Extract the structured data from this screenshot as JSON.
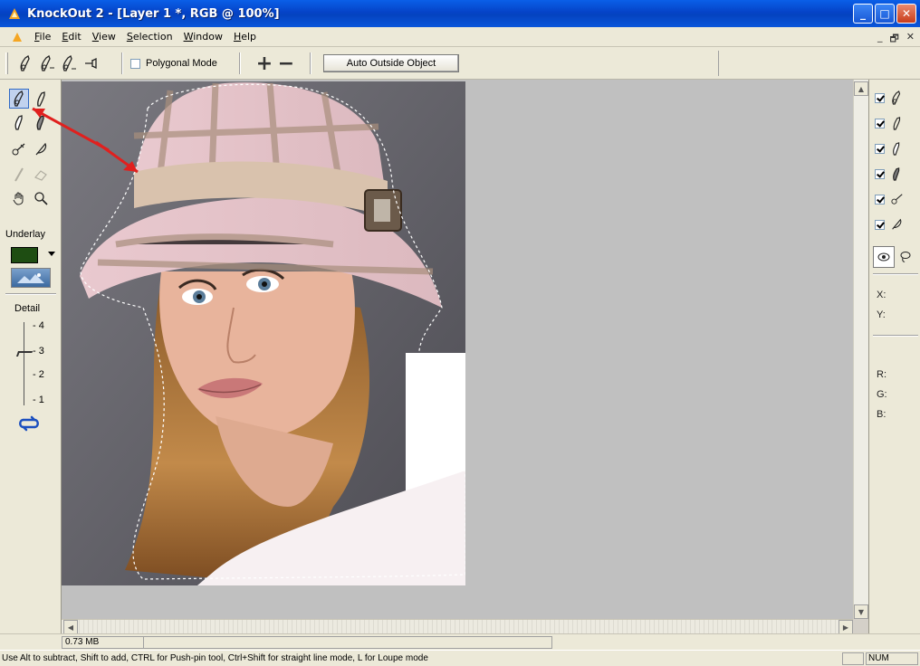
{
  "window": {
    "title": "KnockOut 2 - [Layer 1 *, RGB @ 100%]",
    "controls": {
      "minimize": "_",
      "maximize": "□",
      "close": "✕"
    }
  },
  "menu": {
    "items": [
      "File",
      "Edit",
      "View",
      "Selection",
      "Window",
      "Help"
    ],
    "mdi_controls": {
      "minimize": "_",
      "restore": "🗗",
      "close": "✕"
    }
  },
  "toolbar": {
    "tools": [
      "inside-object-icon",
      "inside-object-add-icon",
      "inside-object-sub-icon",
      "pushpin-icon"
    ],
    "polygonal_mode_label": "Polygonal Mode",
    "polygonal_mode_checked": false,
    "plus_label": "+",
    "minus_label": "−",
    "auto_outside_label": "Auto Outside Object"
  },
  "left_panel": {
    "underlay_label": "Underlay",
    "underlay_color": "#1e4d12",
    "detail_label": "Detail",
    "detail_ticks": [
      "- 4",
      "- 3",
      "- 2",
      "- 1"
    ],
    "detail_value": 3
  },
  "right_panel": {
    "layers": [
      {
        "icon": "inside-object-icon",
        "checked": true
      },
      {
        "icon": "outside-object-icon",
        "checked": true
      },
      {
        "icon": "inside-brush-icon",
        "checked": true
      },
      {
        "icon": "outside-brush-icon",
        "checked": true
      },
      {
        "icon": "recovery-icon",
        "checked": true
      },
      {
        "icon": "feather-icon",
        "checked": true
      }
    ],
    "coords": {
      "x_label": "X:",
      "y_label": "Y:"
    },
    "color_readout": {
      "r_label": "R:",
      "g_label": "G:",
      "b_label": "B:"
    }
  },
  "statusbar": {
    "memory": "0.73 MB",
    "hint": "Use Alt to subtract, Shift to add, CTRL for Push-pin tool, Ctrl+Shift for straight line mode, L for Loupe mode",
    "num_indicator": "NUM"
  }
}
